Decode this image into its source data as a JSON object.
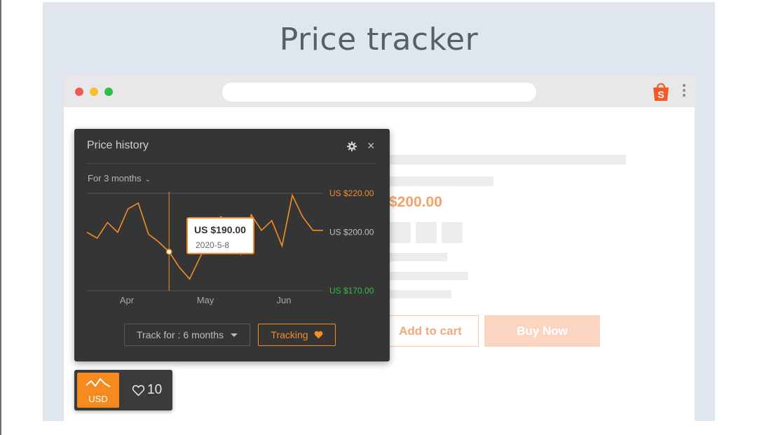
{
  "page": {
    "title": "Price tracker"
  },
  "browser": {
    "window_buttons": [
      "close",
      "minimize",
      "maximize"
    ],
    "extension_icon": "shopping-bag-icon",
    "extension_icon_letter": "S",
    "menu_icon": "kebab-menu-icon"
  },
  "product": {
    "price": "$200.00",
    "add_to_cart": "Add to cart",
    "buy_now": "Buy Now"
  },
  "price_history": {
    "title": "Price history",
    "range_label": "For 3 months",
    "tooltip_price": "US $190.00",
    "tooltip_date": "2020-5-8",
    "track_label": "Track for : 6 months",
    "tracking_label": "Tracking",
    "colors": {
      "line": "#f38d2a",
      "max": "#f38d2a",
      "min": "#2fbf4a",
      "accent": "#f58a1f"
    }
  },
  "chart_data": {
    "type": "line",
    "x_ticks": [
      "Apr",
      "May",
      "Jun"
    ],
    "y_ticks": [
      {
        "value": 220,
        "label": "US $220.00",
        "role": "max"
      },
      {
        "value": 200,
        "label": "US $200.00",
        "role": "current"
      },
      {
        "value": 170,
        "label": "US $170.00",
        "role": "min"
      }
    ],
    "ylim": [
      170,
      220
    ],
    "series": [
      {
        "values": [
          200,
          197,
          205,
          200,
          212,
          215,
          199,
          195,
          190,
          182,
          176,
          187,
          197,
          208,
          206,
          189,
          209,
          201,
          206,
          193,
          219,
          208,
          201,
          201
        ]
      }
    ],
    "highlight": {
      "index": 8,
      "value": 190,
      "date": "2020-5-8"
    },
    "grid": true
  },
  "widget": {
    "currency": "USD",
    "favorites": "10"
  }
}
